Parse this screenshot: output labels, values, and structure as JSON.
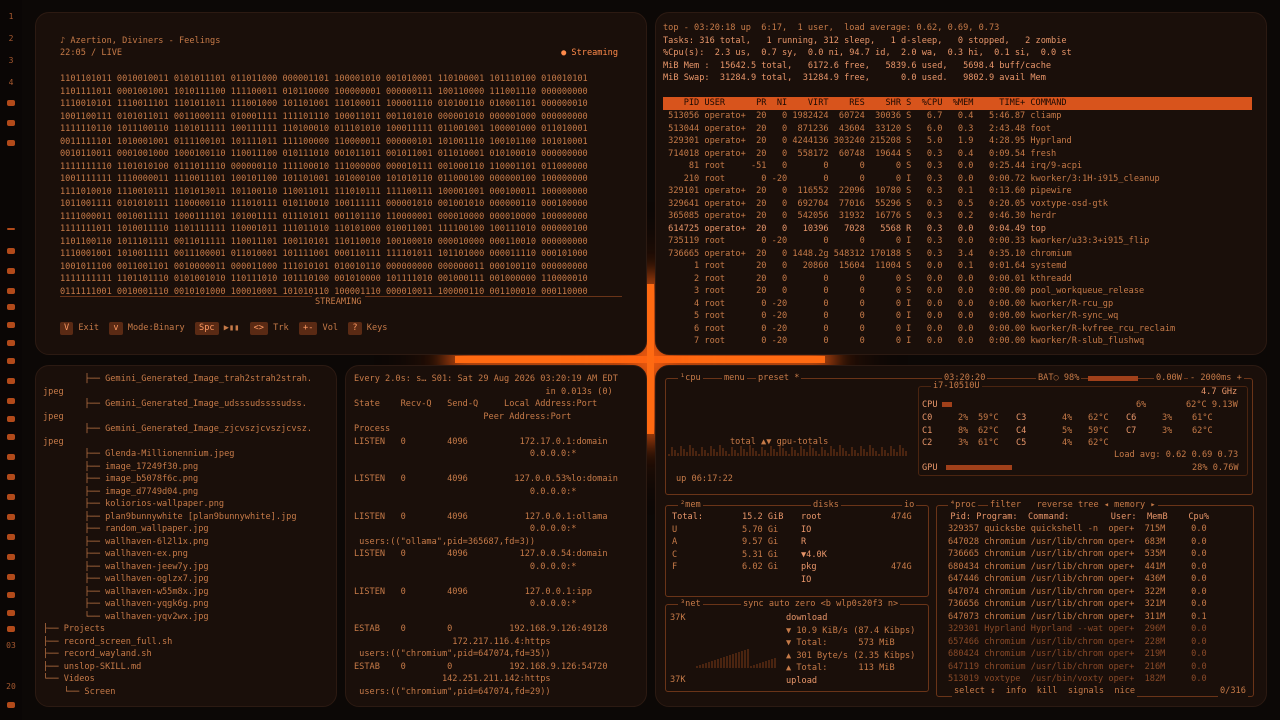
{
  "bar": {
    "ws": [
      "1",
      "2",
      "3",
      "4"
    ],
    "bottom": [
      "03",
      "20"
    ]
  },
  "player": {
    "song": "♪ Azertion, Diviners - Feelings",
    "time": "22:05 / LIVE",
    "status": "● Streaming",
    "rows": [
      "1101101011 0010010011 0101011101 011011000 000001101 100001010 001010001 110100001 101110100 010010101",
      "1101111011 0001001001 1010111100 111100011 010110000 100000001 000000111 100110000 111001110 000000000",
      "1110010101 1110011101 1101011011 111001000 101101001 110100011 100001110 010100110 010001101 000000010",
      "1001100111 0101011011 0011000111 010001111 111101110 100011011 001101010 000001010 000001000 000000000",
      "1111110110 1011100110 1101011111 100111111 110100010 011101010 100011111 011001001 100001000 011010001",
      "0011111101 1010001001 0111100101 101111011 111100000 110000011 000000101 101001110 100101100 101010001",
      "0010110011 0001001000 1000100110 110011100 010111010 001011011 001011001 011010001 010100010 000000000",
      "1111111110 1101010100 0111011110 000000110 111100010 111000000 000010111 001000110 110001101 011000000",
      "1001111111 1110000011 1110011101 100101100 101101001 101000100 101010110 011000100 000000100 100000000",
      "1111010010 1110010111 1101013011 101100110 110011011 111010111 111100111 100001001 000100011 100000000",
      "1011001111 0101010111 1100000110 111010111 010110010 100111111 000001010 001001010 000000110 000100000",
      "1111000011 0010011111 1000111101 101001111 011101011 001101110 110000001 000010000 000010000 100000000",
      "1111111011 1010011110 1101111111 110001011 111011010 110101000 010011001 111100100 100111010 000000100",
      "1101100110 1011101111 0011011111 110011101 100110101 110110010 100100010 000010000 000110010 000000000",
      "1110001001 1010011111 0011100001 011010001 101111001 000110111 111101011 101101000 000011110 000101000",
      "1001011100 0011001101 0010000011 000011000 111010101 010010110 000000000 000000011 000100110 000000000",
      "1111111111 1101101110 0101001010 110111010 101110100 001010000 101111010 001000111 001000000 110000010",
      "0111111001 0010001110 0010101000 100010001 101010110 100001110 000010011 100000110 001100010 000110000"
    ],
    "mode": "STREAMING",
    "keys": [
      [
        "V",
        "Exit"
      ],
      [
        "v",
        "Mode:Binary"
      ],
      [
        "Spc",
        "▶▮▮"
      ],
      [
        "<>",
        "Trk"
      ],
      [
        "+-",
        "Vol"
      ],
      [
        "?",
        "Keys"
      ]
    ]
  },
  "top": {
    "summary": [
      "top - 03:20:18 up  6:17,  1 user,  load average: 0.62, 0.69, 0.73",
      "Tasks: 316 total,   1 running, 312 sleep,   1 d-sleep,   0 stopped,   2 zombie",
      "%Cpu(s):  2.3 us,  0.7 sy,  0.0 ni, 94.7 id,  2.0 wa,  0.3 hi,  0.1 si,  0.0 st",
      "MiB Mem :  15642.5 total,   6172.6 free,   5839.6 used,   5698.4 buff/cache",
      "MiB Swap:  31284.9 total,  31284.9 free,      0.0 used.   9802.9 avail Mem"
    ],
    "header": "    PID USER      PR  NI    VIRT    RES    SHR S  %CPU  %MEM     TIME+ COMMAND",
    "procs": [
      " 513056 operato+  20   0 1982424  60724  30036 S   6.7   0.4   5:46.87 cliamp",
      " 513044 operato+  20   0  871236  43604  33120 S   6.0   0.3   2:43.48 foot",
      " 329301 operato+  20   0 4244136 303240 215208 S   5.0   1.9   4:28.95 Hyprland",
      " 714018 operato+  20   0  558172  60748  19644 S   0.3   0.4   0:09.54 fresh",
      "     81 root     -51   0       0      0      0 S   0.3   0.0   0:25.44 irq/9-acpi",
      "    210 root       0 -20       0      0      0 I   0.3   0.0   0:00.72 kworker/3:1H-i915_cleanup",
      " 329101 operato+  20   0  116552  22096  10780 S   0.3   0.1   0:13.60 pipewire",
      " 329641 operato+  20   0  692704  77016  55296 S   0.3   0.5   0:20.05 voxtype-osd-gtk",
      " 365085 operato+  20   0  542056  31932  16776 S   0.3   0.2   0:46.30 herdr",
      " 614725 operato+  20   0   10396   7028   5568 R   0.3   0.0   0:04.49 top",
      " 735119 root       0 -20       0      0      0 I   0.3   0.0   0:00.33 kworker/u33:3+i915_flip",
      " 736665 operato+  20   0 1448.2g 548312 170188 S   0.3   3.4   0:35.10 chromium",
      "      1 root      20   0   20860  15604  11004 S   0.0   0.1   0:01.64 systemd",
      "      2 root      20   0       0      0      0 S   0.0   0.0   0:00.01 kthreadd",
      "      3 root      20   0       0      0      0 S   0.0   0.0   0:00.00 pool_workqueue_release",
      "      4 root       0 -20       0      0      0 I   0.0   0.0   0:00.00 kworker/R-rcu_gp",
      "      5 root       0 -20       0      0      0 I   0.0   0.0   0:00.00 kworker/R-sync_wq",
      "      6 root       0 -20       0      0      0 I   0.0   0.0   0:00.00 kworker/R-kvfree_rcu_reclaim",
      "      7 root       0 -20       0      0      0 I   0.0   0.0   0:00.00 kworker/R-slub_flushwq"
    ]
  },
  "tree": [
    "        ├── Gemini_Generated_Image_trah2strah2strah.",
    "jpeg",
    "        ├── Gemini_Generated_Image_udsssudssssudss.",
    "jpeg",
    "        ├── Gemini_Generated_Image_zjcvszjcvszjcvsz.",
    "jpeg",
    "        ├── Glenda-Millionennium.jpeg",
    "        ├── image_17249f30.png",
    "        ├── image_b5078f6c.png",
    "        ├── image_d7749d04.png",
    "        ├── koliorios-wallpaper.png",
    "        ├── plan9bunnywhite [plan9bunnywhite].jpg",
    "        ├── random_wallpaper.jpg",
    "        ├── wallhaven-6l2l1x.png",
    "        ├── wallhaven-ex.png",
    "        ├── wallhaven-jeew7y.jpg",
    "        ├── wallhaven-oglzx7.jpg",
    "        ├── wallhaven-w55m8x.jpg",
    "        ├── wallhaven-yqgk6g.png",
    "        └── wallhaven-yqv2wx.jpg",
    "├── Projects",
    "├── record_screen_full.sh",
    "├── record_wayland.sh",
    "├── unslop-SKILL.md",
    "└── Videos",
    "    └── Screen"
  ],
  "ss": [
    "Every 2.0s: s… S01: Sat 29 Aug 2026 03:20:19 AM EDT",
    "                                     in 0.013s (0)",
    "State    Recv-Q   Send-Q     Local Address:Port",
    "                         Peer Address:Port",
    "Process",
    "LISTEN   0        4096          172.17.0.1:domain",
    "                                  0.0.0.0:*",
    "",
    "LISTEN   0        4096         127.0.0.53%lo:domain",
    "                                  0.0.0.0:*",
    "",
    "LISTEN   0        4096           127.0.0.1:ollama",
    "                                  0.0.0.0:*",
    " users:((\"ollama\",pid=365687,fd=3))",
    "LISTEN   0        4096          127.0.0.54:domain",
    "                                  0.0.0.0:*",
    "",
    "LISTEN   0        4096           127.0.0.1:ipp",
    "                                  0.0.0.0:*",
    "",
    "ESTAB    0        0           192.168.9.126:49128",
    "                   172.217.116.4:https",
    " users:((\"chromium\",pid=647074,fd=35))",
    "ESTAB    0        0           192.168.9.126:54720",
    "                 142.251.211.142:https",
    " users:((\"chromium\",pid=647074,fd=29))"
  ],
  "btop": {
    "cpu_label": "¹cpu",
    "menu": "menu",
    "preset": "preset *",
    "clock": "03:20:20",
    "bat": "BAT○ 98%",
    "pwr": "0.00W",
    "ms": "- 2000ms +",
    "model": "i7-10510U",
    "freq": "4.7 GHz",
    "cpu_pct": "6%",
    "cpu_temp": "62°C 9.13W",
    "cores": [
      [
        "C0",
        "2%",
        "59°C",
        "C3",
        "4%",
        "62°C",
        "C6",
        "3%",
        "61°C"
      ],
      [
        "C1",
        "8%",
        "62°C",
        "C4",
        "5%",
        "59°C",
        "C7",
        "3%",
        "62°C"
      ],
      [
        "C2",
        "3%",
        "61°C",
        "C5",
        "4%",
        "62°C",
        "",
        "",
        ""
      ]
    ],
    "load": "Load avg: 0.62 0.69 0.73",
    "gpu": "GPU",
    "gpu_val": "28% 0.76W",
    "totals": "total ▲▼ gpu-totals",
    "uptime": "up 06:17:22",
    "mem_label": "²mem",
    "disks_label": "disks",
    "io_label": "io",
    "mem": [
      [
        "Total:",
        "15.2 GiB"
      ],
      [
        "U",
        "5.70 Gi"
      ],
      [
        "A",
        "9.57 Gi"
      ],
      [
        "C",
        "5.31 Gi"
      ],
      [
        "F",
        "6.02 Gi"
      ]
    ],
    "disk": [
      [
        "root",
        "474G"
      ],
      [
        "IO",
        ""
      ],
      [
        "R",
        ""
      ],
      [
        "▼4.0K",
        ""
      ],
      [
        "pkg",
        "474G"
      ],
      [
        "IO",
        ""
      ]
    ],
    "net_label": "³net",
    "net_tabs": "sync auto zero <b wlp0s20f3 n>",
    "net_scale": "37K",
    "net": [
      "download",
      "▼ 10.9 KiB/s (87.4 Kibps)",
      "▼ Total:      573 MiB",
      "▲ 301 Byte/s (2.35 Kibps)",
      "▲ Total:      113 MiB",
      "upload"
    ],
    "proc_label": "⁴proc",
    "proc_tabs": "filter   reverse tree ◂ memory ▸",
    "proc_head": "  Pid: Program:  Command:        User:  MemB    Cpu%",
    "procs": [
      "329357 quicksbe quickshell -n  oper+  715M     0.0",
      "647028 chromium /usr/lib/chrom oper+  683M     0.0",
      "736665 chromium /usr/lib/chrom oper+  535M     0.0",
      "680434 chromium /usr/lib/chrom oper+  441M     0.0",
      "647446 chromium /usr/lib/chrom oper+  436M     0.0",
      "647074 chromium /usr/lib/chrom oper+  322M     0.0",
      "736656 chromium /usr/lib/chrom oper+  321M     0.0",
      "647073 chromium /usr/lib/chrom oper+  311M     0.1",
      "329301 Hyprland Hyprland --wat oper+  296M     0.0",
      "657466 chromium /usr/lib/chrom oper+  228M     0.0",
      "680424 chromium /usr/lib/chrom oper+  219M     0.0",
      "647119 chromium /usr/lib/chrom oper+  216M     0.0",
      "513019 voxtype  /usr/bin/voxty oper+  182M     0.0"
    ],
    "proc_foot": "select ↕  info  kill  signals  nice",
    "proc_count": "0/316"
  }
}
